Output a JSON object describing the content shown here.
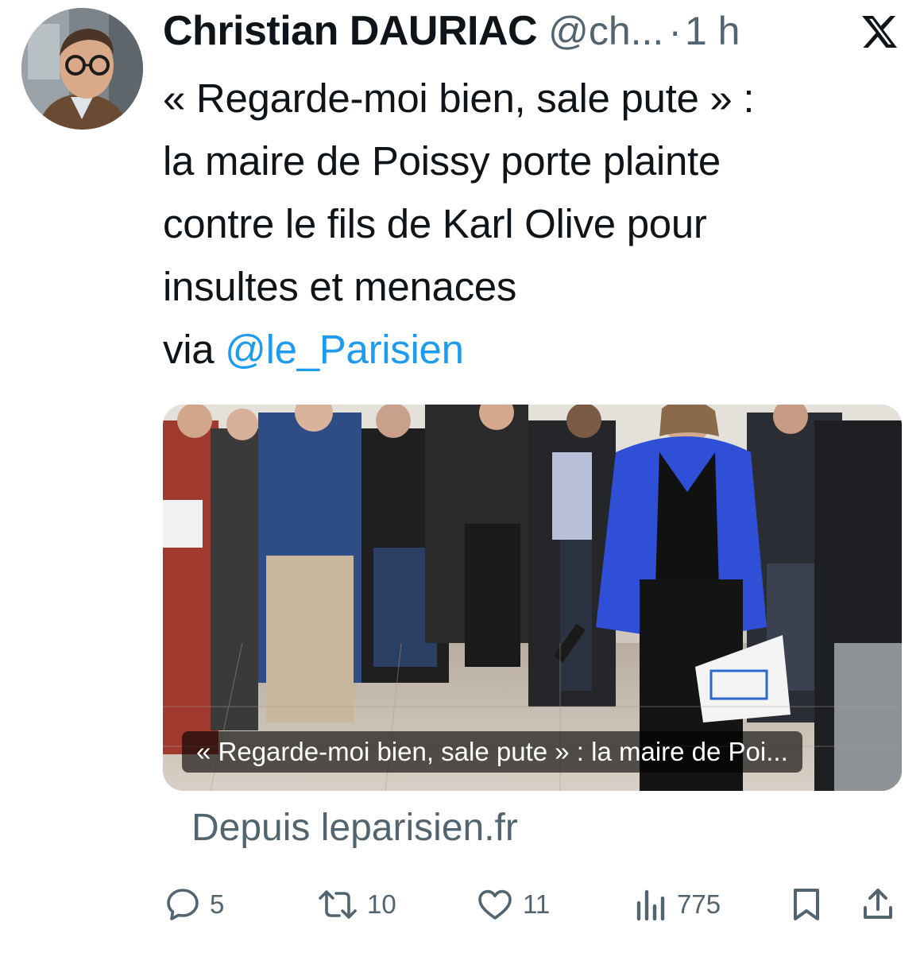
{
  "author": {
    "name": "Christian DAURIAC",
    "handle": "@ch...",
    "separator": "·",
    "time": "1 h"
  },
  "tweet": {
    "lines": [
      "« Regarde-moi bien, sale pute » :",
      "la maire de Poissy porte plainte",
      "contre le fils de Karl Olive pour",
      "insultes et menaces"
    ],
    "via_prefix": "via ",
    "mention": "@le_Parisien"
  },
  "card": {
    "caption": "« Regarde-moi bien, sale pute » : la maire de Poi...",
    "source": "Depuis leparisien.fr"
  },
  "actions": {
    "replies": "5",
    "reposts": "10",
    "likes": "11",
    "views": "775"
  },
  "colors": {
    "text": "#0f1419",
    "secondary": "#536471",
    "link": "#1d9bf0",
    "blazer": "#2f4fd6"
  },
  "icons": [
    "x-logo-icon",
    "reply-icon",
    "repost-icon",
    "like-icon",
    "views-icon",
    "bookmark-icon",
    "share-icon"
  ]
}
